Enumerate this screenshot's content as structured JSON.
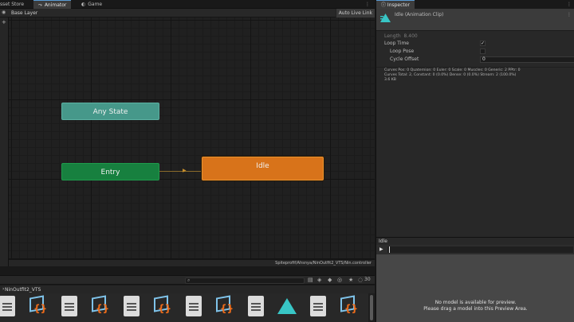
{
  "tabs": [
    {
      "label": "sset Store",
      "icon": ""
    },
    {
      "label": "Animator",
      "icon": "animator-icon",
      "glyph": "⤳"
    },
    {
      "label": "Game",
      "icon": "game-icon",
      "glyph": "◐"
    }
  ],
  "tabbar_controls": "⋮",
  "animator": {
    "layer_label": "Base Layer",
    "auto_live_link": "Auto Live Link",
    "states": {
      "any": "Any State",
      "entry": "Entry",
      "idle": "Idle"
    },
    "path": "Spiteprofif/Ahsnya/NinOutfit2_VTS/Nin.controller"
  },
  "project": {
    "folder": "NinOutfit2_VTS",
    "zoom_value": "30",
    "search_placeholder": "",
    "assets": [
      "doc",
      "cube",
      "doc",
      "cube",
      "doc",
      "cube",
      "doc",
      "cube",
      "doc",
      "tri",
      "doc",
      "cube"
    ]
  },
  "inspector": {
    "tab_label": "Inspector",
    "clip_title": "Idle (Animation Clip)",
    "length_label": "Length",
    "length_value": "8.400",
    "loop_time_label": "Loop Time",
    "loop_time_checked": true,
    "loop_pose_label": "Loop Pose",
    "cycle_offset_label": "Cycle Offset",
    "cycle_offset_value": "0",
    "stats_line1": "Curves Pos: 0 Quaternion: 0 Euler: 0 Scale: 0 Muscles: 0 Generic: 2 PPtr: 0",
    "stats_line2": "Curves Total: 2, Constant: 0 (0.0%) Dense: 0 (0.0%) Stream: 2 (100.0%)",
    "stats_line3": "3.6 KB"
  },
  "preview": {
    "header": "Idle",
    "play_glyph": "▶",
    "message_line1": "No model is available for preview.",
    "message_line2": "Please drag a model into this Preview Area."
  },
  "colors": {
    "any_state": "#46988a",
    "entry": "#17803f",
    "idle": "#d8731a",
    "tab_accent": "#5a9bd5"
  }
}
